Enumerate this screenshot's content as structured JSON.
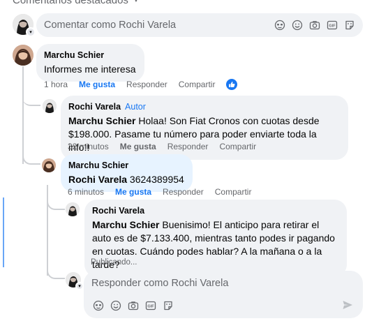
{
  "section": {
    "header": "Comentarios destacados"
  },
  "composer": {
    "placeholder": "Comentar como Rochi Varela",
    "icons": [
      "avatar-sticker-icon",
      "emoji-icon",
      "camera-icon",
      "gif-icon",
      "sticker-icon"
    ]
  },
  "comments": [
    {
      "author": "Marchu Schier",
      "text": "Informes me interesa",
      "time": "1 hora",
      "like": "Me gusta",
      "reply": "Responder",
      "share": "Compartir",
      "reaction": "like-reaction-icon"
    },
    {
      "author": "Rochi Varela",
      "role": "Autor",
      "mention": "Marchu Schier",
      "text": " Holaa! Son Fiat Cronos con cuotas desde $198.000. Pasame tu número para poder enviarte toda la info!!",
      "time": "32 minutos",
      "like": "Me gusta",
      "reply": "Responder",
      "share": "Compartir"
    },
    {
      "author": "Marchu Schier",
      "mention": "Rochi Varela",
      "text": " 3624389954",
      "time": "6 minutos",
      "like": "Me gusta",
      "reply": "Responder",
      "share": "Compartir"
    },
    {
      "author": "Rochi Varela",
      "mention": "Marchu Schier",
      "text": " Buenisimo! El anticipo para retirar el auto es de $7.133.400, mientras tanto podes ir pagando en cuotas. Cuándo podes hablar? A la mañana o a la tarde?",
      "status": "Publicando..."
    }
  ],
  "reply_composer": {
    "placeholder": "Responder como Rochi Varela",
    "icons": [
      "avatar-sticker-icon",
      "emoji-icon",
      "camera-icon",
      "gif-icon",
      "sticker-icon"
    ],
    "send_icon": "send-icon"
  },
  "colors": {
    "accent": "#1877f2",
    "bubble": "#f0f2f5",
    "bubble_highlight": "#e7f3ff",
    "muted_text": "#65676b"
  }
}
